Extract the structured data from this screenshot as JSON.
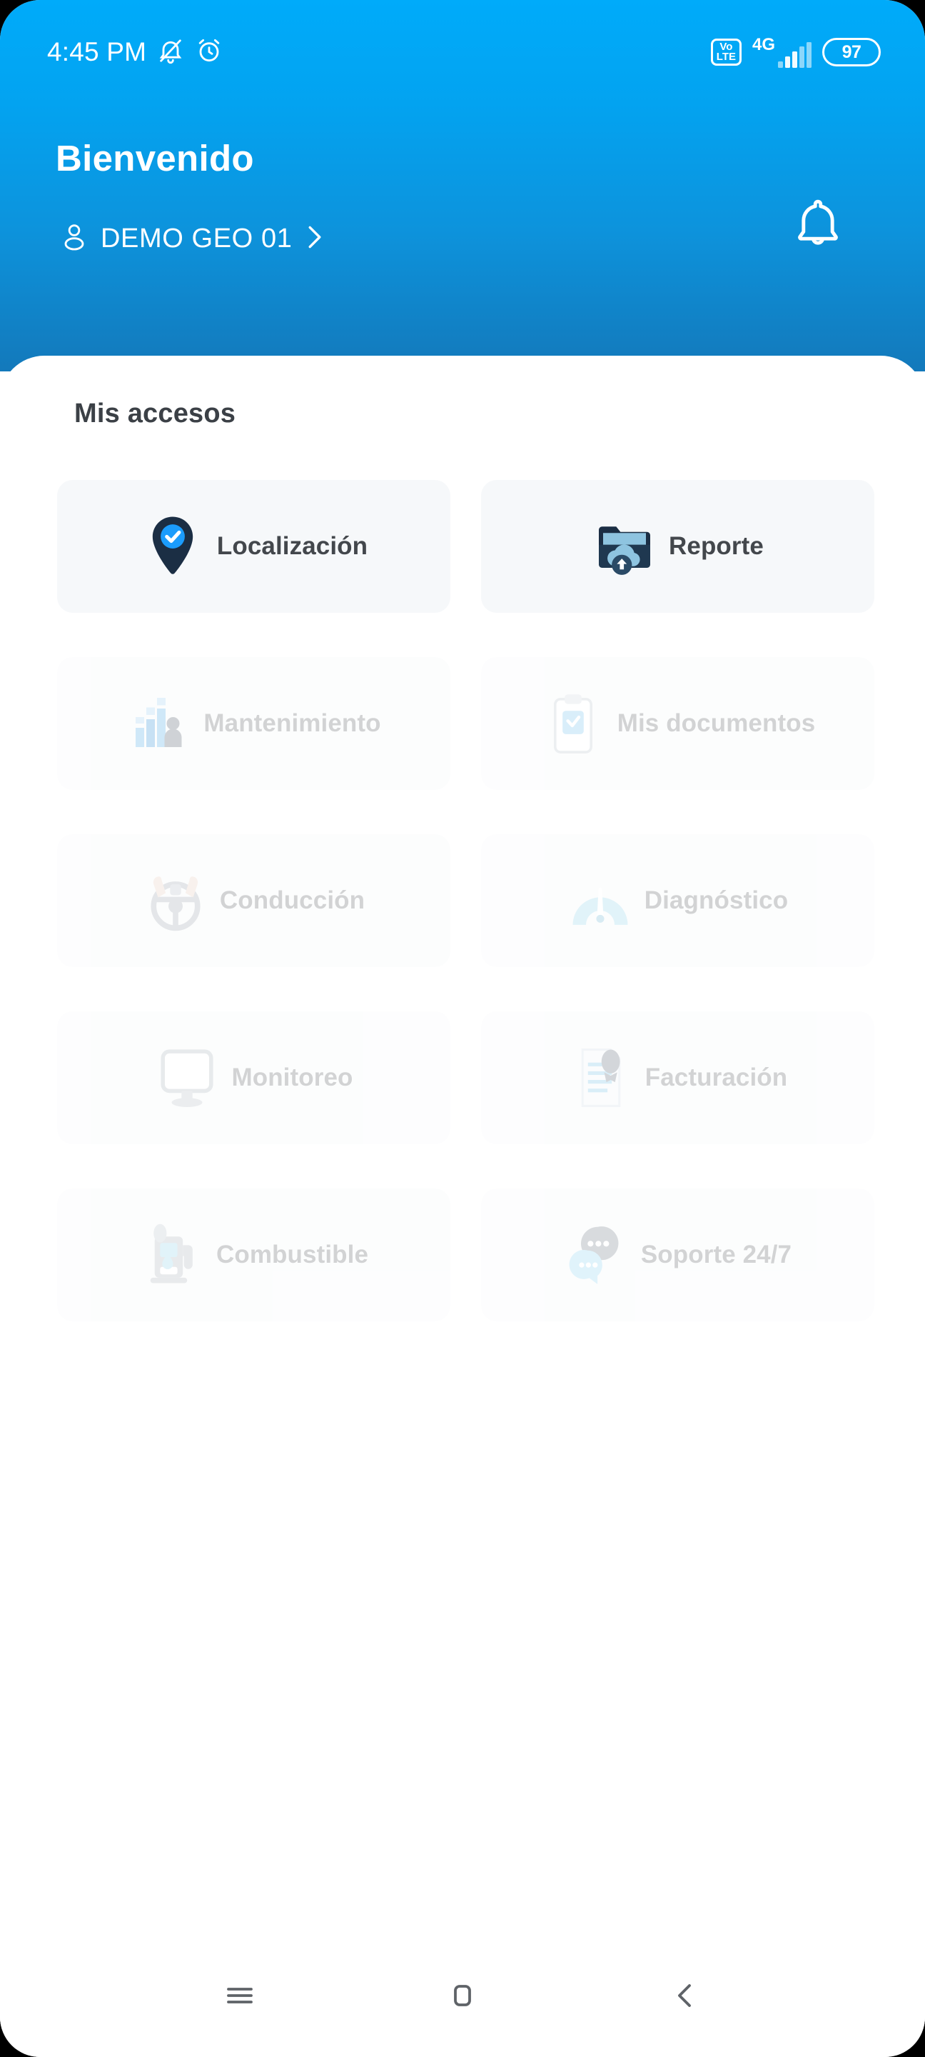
{
  "status_bar": {
    "time": "4:45 PM",
    "mute_icon": "bell-muted-icon",
    "alarm_icon": "alarm-clock-icon",
    "volte_line1": "Vo",
    "volte_line2": "LTE",
    "network": "4G",
    "signal_bars": 5,
    "battery_level": "97"
  },
  "header": {
    "title": "Bienvenido",
    "user_name": "DEMO GEO 01",
    "user_icon": "person-icon",
    "chevron_icon": "chevron-right-icon",
    "bell_icon": "bell-icon",
    "gradient_top": "#00ABFA",
    "gradient_bottom": "#1379BB"
  },
  "main": {
    "section_title": "Mis accesos",
    "card_bg": "#f6f8fa",
    "accent": "#1B9CFC",
    "icon_navy": "#1b2e44",
    "items": [
      {
        "label": "Localización",
        "icon": "map-pin-check-icon",
        "enabled": true
      },
      {
        "label": "Reporte",
        "icon": "folder-cloud-upload-icon",
        "enabled": true
      },
      {
        "label": "Mantenimiento",
        "icon": "bar-chart-worker-icon",
        "enabled": false
      },
      {
        "label": "Mis documentos",
        "icon": "clipboard-check-icon",
        "enabled": false
      },
      {
        "label": "Conducción",
        "icon": "steering-wheel-icon",
        "enabled": false
      },
      {
        "label": "Diagnóstico",
        "icon": "gauge-icon",
        "enabled": false
      },
      {
        "label": "Monitoreo",
        "icon": "monitor-icon",
        "enabled": false
      },
      {
        "label": "Facturación",
        "icon": "invoice-icon",
        "enabled": false
      },
      {
        "label": "Combustible",
        "icon": "fuel-pump-icon",
        "enabled": false
      },
      {
        "label": "Soporte 24/7",
        "icon": "chat-bubbles-icon",
        "enabled": false
      }
    ]
  },
  "nav_bar": {
    "recents_icon": "menu-icon",
    "home_icon": "home-square-icon",
    "back_icon": "back-chevron-icon"
  }
}
